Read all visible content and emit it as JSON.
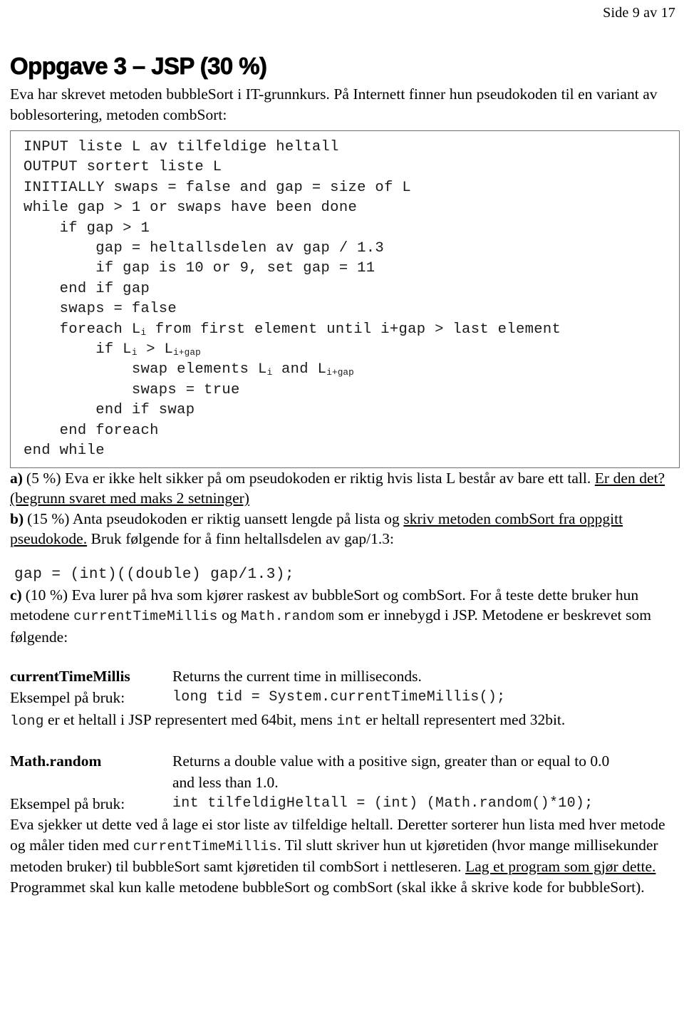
{
  "header": {
    "page_indicator": "Side 9 av 17"
  },
  "task": {
    "title": "Oppgave 3 – JSP (30 %)",
    "intro": "Eva har skrevet metoden bubbleSort i IT-grunnkurs. På Internett finner hun pseudokoden til en variant av boblesortering, metoden combSort:"
  },
  "pseudocode": {
    "lines": [
      "INPUT liste L av tilfeldige heltall",
      "OUTPUT sortert liste L",
      "INITIALLY swaps = false and gap = size of L",
      "while gap > 1 or swaps have been done",
      "    if gap > 1",
      "        gap = heltallsdelen av gap / 1.3",
      "        if gap is 10 or 9, set gap = 11",
      "    end if gap",
      "    swaps = false",
      "    foreach L_i from first element until i+gap > last element",
      "        if L_i > L_i+gap",
      "            swap elements L_i and L_i+gap",
      "            swaps = true",
      "        end if swap",
      "    end foreach",
      "end while"
    ]
  },
  "items": {
    "a": {
      "lead": "a)",
      "percent": "(5 %)",
      "text_plain": " Eva er ikke helt sikker på om pseudokoden er riktig hvis lista L består av bare ett tall. ",
      "text_underlined": "Er den det? (begrunn svaret med maks 2 setninger)"
    },
    "b": {
      "lead": "b)",
      "percent": "(15 %)",
      "text_plain_1": " Anta pseudokoden er riktig uansett lengde på lista og ",
      "text_underlined": "skriv metoden combSort fra oppgitt pseudokode.",
      "text_plain_2": " Bruk følgende for å finn heltallsdelen av gap/1.3:",
      "code": "gap = (int)((double) gap/1.3);"
    },
    "c": {
      "lead": "c)",
      "percent": "(10 %)",
      "text_1": " Eva lurer på hva som kjører raskest av bubbleSort og combSort. For å teste dette bruker hun metodene ",
      "code_1": "currentTimeMillis",
      "text_2": " og ",
      "code_2": "Math.random",
      "text_3": " som er innebygd i JSP. Metodene er beskrevet som følgende:"
    }
  },
  "methods": [
    {
      "name": "currentTimeMillis",
      "description": "Returns the current time in milliseconds.",
      "description_line2": "",
      "example_label": "Eksempel på bruk:",
      "example_code": "long tid = System.currentTimeMillis();"
    },
    {
      "name": "Math.random",
      "description": "Returns a double value with a positive sign, greater than or equal to 0.0",
      "description_line2": "and less than 1.0.",
      "example_label": "Eksempel på bruk:",
      "example_code": "int tilfeldigHeltall = (int) (Math.random()*10);"
    }
  ],
  "note": {
    "code_long": "long",
    "text_1": " er et heltall i JSP representert med 64bit, mens ",
    "code_int": "int",
    "text_2": " er heltall representert med 32bit."
  },
  "closing": {
    "text_1": "Eva sjekker ut dette ved å lage ei stor liste av tilfeldige heltall. Deretter sorterer hun lista med hver metode og måler tiden med ",
    "code_1": "currentTimeMillis",
    "text_2": ". Til slutt skriver hun ut kjøretiden (hvor mange millisekunder metoden bruker) til bubbleSort samt kjøretiden til combSort i nettleseren. ",
    "text_underlined": "Lag et program som gjør dette.",
    "text_3": " Programmet skal kun kalle metodene bubbleSort og combSort (skal ikke å skrive kode for bubbleSort)."
  }
}
